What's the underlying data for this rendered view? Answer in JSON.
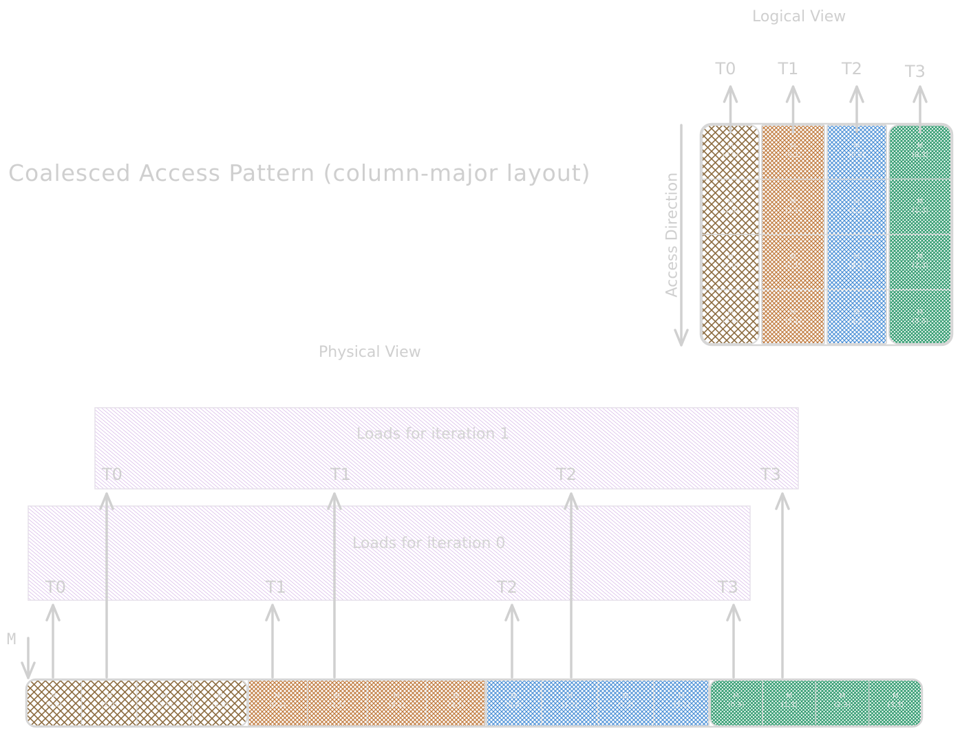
{
  "title": "Coalesced Access Pattern (column-major layout)",
  "logical_view": {
    "title": "Logical View",
    "threads": [
      "T0",
      "T1",
      "T2",
      "T3"
    ],
    "access_direction_label": "Access Direction",
    "grid": [
      [
        "M\n(0,0)",
        "M\n(0,1)",
        "M\n(0,2)",
        "M\n(0,3)"
      ],
      [
        "M\n(1,0)",
        "M\n(1,1)",
        "M\n(1,2)",
        "M\n(1,3)"
      ],
      [
        "M\n(2,0)",
        "M\n(2,1)",
        "M\n(2,2)",
        "M\n(2,3)"
      ],
      [
        "M\n(3,0)",
        "M\n(3,1)",
        "M\n(3,2)",
        "M\n(3,3)"
      ]
    ]
  },
  "physical_view": {
    "title": "Physical View",
    "memory_label": "M",
    "iterations": [
      {
        "label": "Loads for iteration 0",
        "threads": [
          "T0",
          "T1",
          "T2",
          "T3"
        ],
        "cells": [
          0,
          4,
          8,
          12
        ]
      },
      {
        "label": "Loads for iteration 1",
        "threads": [
          "T0",
          "T1",
          "T2",
          "T3"
        ],
        "cells": [
          1,
          5,
          9,
          13
        ]
      }
    ],
    "cells": [
      "M\n(0,0)",
      "M\n(1,0)",
      "M\n(2,0)",
      "M\n(3,0)",
      "M\n(0,1)",
      "M\n(1,1)",
      "M\n(2,1)",
      "M\n(3,1)",
      "M\n(0,2)",
      "M\n(1,2)",
      "M\n(2,2)",
      "M\n(3,2)",
      "M\n(0,3)",
      "M\n(1,3)",
      "M\n(2,3)",
      "M\n(3,3)"
    ]
  },
  "colors": {
    "column_0": "#8b6a3e",
    "column_1": "#c07a3e",
    "column_2": "#4a8fd6",
    "column_3": "#2f9a6e",
    "load_bar": "#c9a0e0",
    "ink": "#d0d0d0"
  }
}
